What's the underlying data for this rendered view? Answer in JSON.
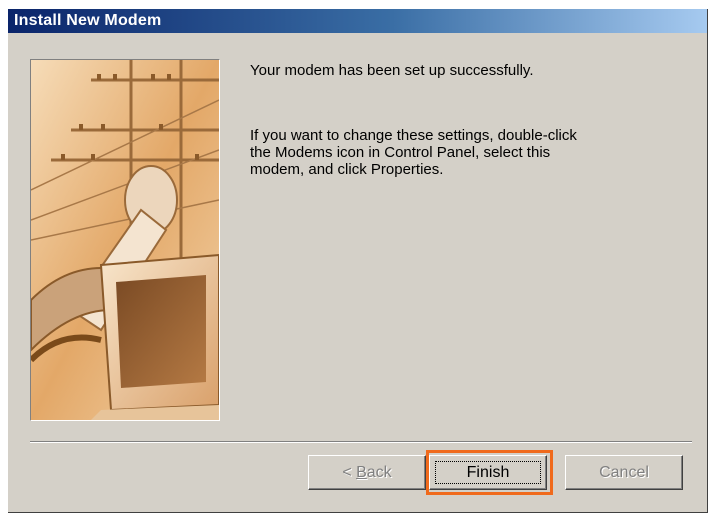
{
  "window": {
    "title": "Install New Modem"
  },
  "content": {
    "success_message": "Your modem has been set up successfully.",
    "instructions_line1": "If you want to change these settings, double-click",
    "instructions_line2": "the Modems icon in Control Panel, select this",
    "instructions_line3": "modem, and click Properties."
  },
  "buttons": {
    "back_prefix": "< ",
    "back_mnemonic": "B",
    "back_rest": "ack",
    "back_enabled": false,
    "finish_label": "Finish",
    "finish_enabled": true,
    "finish_highlighted": true,
    "cancel_label": "Cancel",
    "cancel_enabled": false
  },
  "colors": {
    "highlight": "#f06a1c",
    "titlebar_start": "#0a246a",
    "titlebar_end": "#a6caf0",
    "dialog_bg": "#d4d0c8"
  },
  "images": {
    "wizard_image": "modem-setup-illustration"
  }
}
